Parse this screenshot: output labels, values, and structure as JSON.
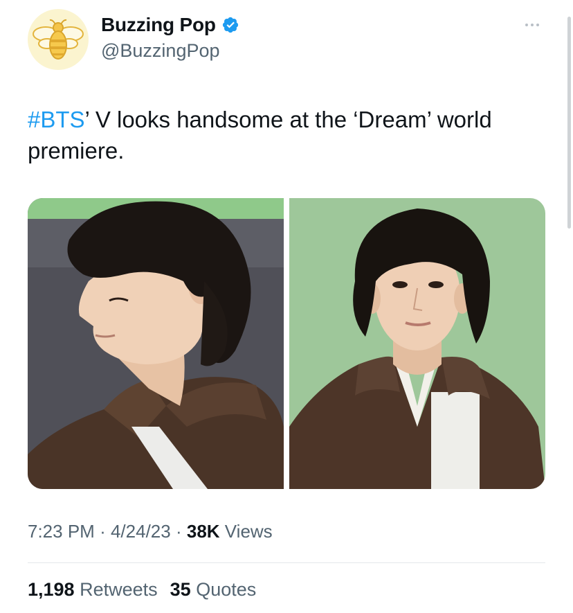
{
  "account": {
    "display_name": "Buzzing Pop",
    "handle": "@BuzzingPop",
    "avatar_icon": "bee-logo-icon",
    "verified_icon": "verified-badge-icon",
    "verified_color": "#1d9bf0"
  },
  "tweet": {
    "hashtag": "#BTS",
    "text_rest": "’ V looks handsome at the ‘Dream’ world premiere."
  },
  "media": [
    {
      "alt_icon": "photo-profile-left"
    },
    {
      "alt_icon": "photo-front-facing"
    }
  ],
  "meta": {
    "time": "7:23 PM",
    "date": "4/24/23",
    "separator": "·",
    "views_count": "38K",
    "views_label": "Views"
  },
  "stats": {
    "retweets_count": "1,198",
    "retweets_label": "Retweets",
    "quotes_count": "35",
    "quotes_label": "Quotes"
  },
  "colors": {
    "link": "#1d9bf0",
    "secondary_text": "#536471",
    "primary_text": "#0f1419"
  }
}
